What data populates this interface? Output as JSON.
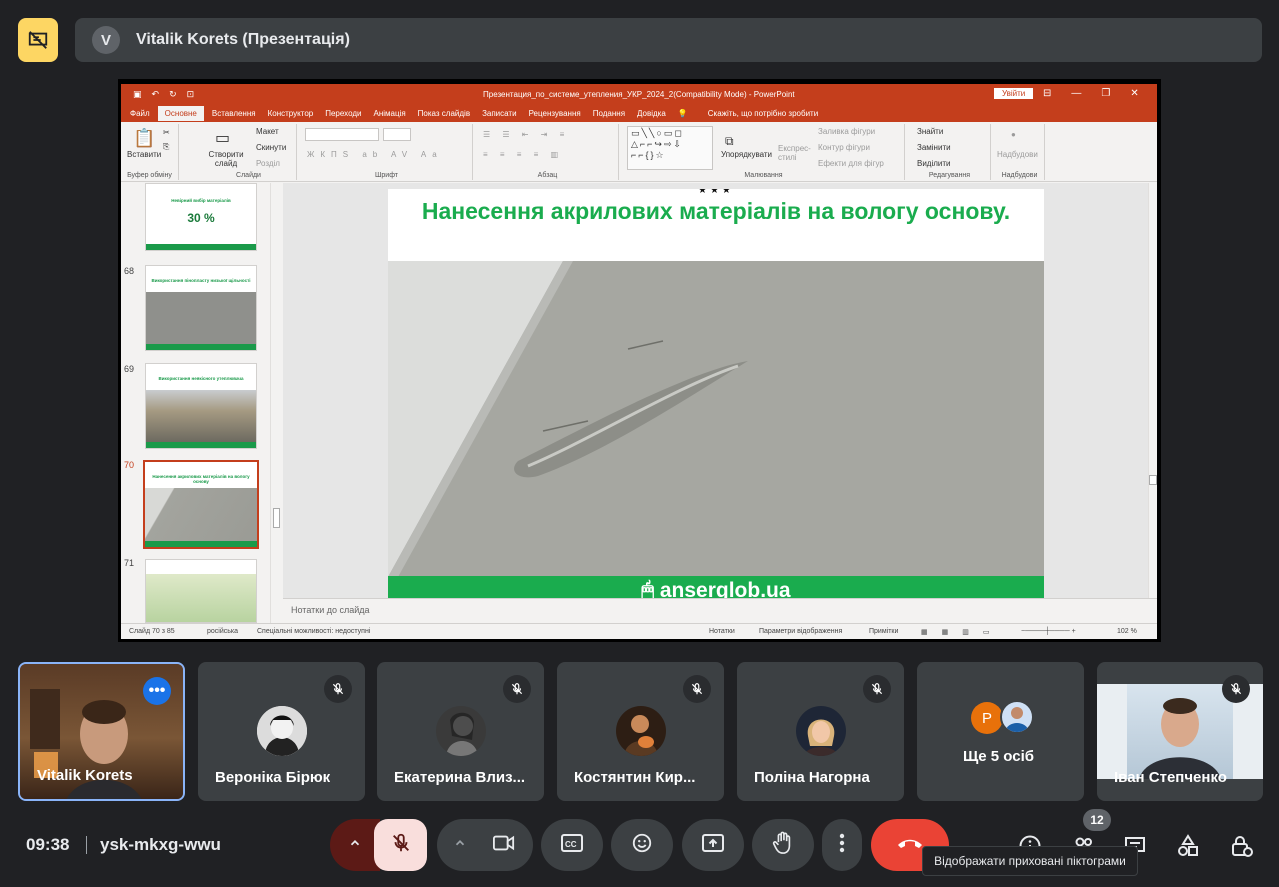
{
  "presenter": {
    "initial": "V",
    "name": "Vitalik Korets (Презентація)"
  },
  "powerpoint": {
    "document_title": "Презентация_по_системе_утепления_УКР_2024_2(Compatibility Mode)  -  PowerPoint",
    "signin_label": "Увійти",
    "tabs": [
      "Файл",
      "Основне",
      "Вставлення",
      "Конструктор",
      "Переходи",
      "Анімація",
      "Показ слайдів",
      "Записати",
      "Рецензування",
      "Подання",
      "Довідка"
    ],
    "active_tab": "Основне",
    "tell_me": "Скажіть, що потрібно зробити",
    "ribbon": {
      "paste": "Вставити",
      "clipboard_group": "Буфер обміну",
      "new_slide": "Створити слайд",
      "layout": "Макет",
      "reset": "Скинути",
      "section": "Розділ",
      "slides_group": "Слайди",
      "font_group": "Шрифт",
      "paragraph_group": "Абзац",
      "arrange": "Упорядкувати",
      "quick_styles": "Експрес-стилі",
      "shape_fill": "Заливка фігури",
      "shape_outline": "Контур фігури",
      "shape_effects": "Ефекти для фігур",
      "drawing_group": "Малювання",
      "find": "Знайти",
      "replace": "Замінити",
      "select": "Виділити",
      "editing_group": "Редагування",
      "addins": "Надбудови",
      "addins_group": "Надбудови"
    },
    "thumbnails": [
      {
        "num": "",
        "title": "Невірний вибір матеріалів",
        "big": "30 %",
        "footer": "anserglob.ua"
      },
      {
        "num": "68",
        "title": "Використання пінопласту низької щільності",
        "footer": "anserglob.ua"
      },
      {
        "num": "69",
        "title": "Використання неякісного утеплювача",
        "footer": "anserglob.ua"
      },
      {
        "num": "70",
        "title": "Нанесення акрилових матеріалів на вологу основу",
        "footer": "anserglob.ua"
      },
      {
        "num": "71",
        "title": "",
        "footer": ""
      }
    ],
    "slide": {
      "stars": "★★★",
      "title": "Нанесення акрилових матеріалів на вологу основу.",
      "footer": "anserglob.ua"
    },
    "notes_placeholder": "Нотатки до слайда",
    "status": {
      "slide_counter": "Слайд 70 з 85",
      "language": "російська",
      "accessibility": "Спеціальні можливості: недоступні",
      "notes": "Нотатки",
      "display_settings": "Параметри відображення",
      "comments": "Примітки",
      "zoom": "102 %"
    }
  },
  "participants": [
    {
      "name": "Vitalik Korets",
      "self": true
    },
    {
      "name": "Вероніка Бірюк",
      "muted": true
    },
    {
      "name": "Екатерина Влиз...",
      "muted": true
    },
    {
      "name": "Костянтин Кир...",
      "muted": true
    },
    {
      "name": "Поліна Нагорна",
      "muted": true
    },
    {
      "name": "Ще 5 осіб",
      "initial": "P"
    },
    {
      "name": "Іван Степченко",
      "muted": true
    }
  ],
  "meeting": {
    "time": "09:38",
    "code": "ysk-mkxg-wwu",
    "people_count": "12",
    "tooltip": "Відображати приховані піктограми"
  },
  "colors": {
    "accent": "#8ab4f8",
    "end_call": "#ea4335",
    "ppt": "#c43e1c",
    "brand_green": "#1aac4e"
  }
}
